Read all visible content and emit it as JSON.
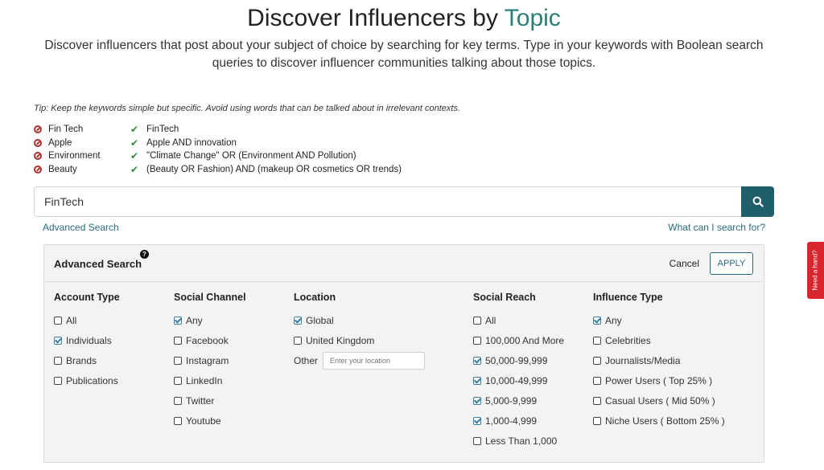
{
  "header": {
    "title_main": "Discover Influencers by",
    "title_accent": "Topic",
    "subtitle": "Discover influencers that post about your subject of choice by searching for key terms. Type in your keywords with Boolean search queries to discover influencer communities talking about those topics."
  },
  "tip": "Tip: Keep the keywords simple but specific. Avoid using words that can be talked about in irrelevant contexts.",
  "examples": [
    {
      "bad": "Fin Tech",
      "good": "FinTech"
    },
    {
      "bad": "Apple",
      "good": "Apple AND innovation"
    },
    {
      "bad": "Environment",
      "good": "\"Climate Change\" OR (Environment AND Pollution)"
    },
    {
      "bad": "Beauty",
      "good": "(Beauty OR Fashion) AND (makeup OR cosmetics OR trends)"
    }
  ],
  "search": {
    "value": "FinTech",
    "advanced_link": "Advanced Search",
    "help_link": "What can I search for?"
  },
  "advanced": {
    "title": "Advanced Search",
    "help_glyph": "?",
    "cancel_label": "Cancel",
    "apply_label": "APPLY",
    "account_type": {
      "heading": "Account Type",
      "options": [
        {
          "label": "All",
          "checked": false
        },
        {
          "label": "Individuals",
          "checked": true
        },
        {
          "label": "Brands",
          "checked": false
        },
        {
          "label": "Publications",
          "checked": false
        }
      ]
    },
    "social_channel": {
      "heading": "Social Channel",
      "options": [
        {
          "label": "Any",
          "checked": true
        },
        {
          "label": "Facebook",
          "checked": false
        },
        {
          "label": "Instagram",
          "checked": false
        },
        {
          "label": "LinkedIn",
          "checked": false
        },
        {
          "label": "Twitter",
          "checked": false
        },
        {
          "label": "Youtube",
          "checked": false
        }
      ]
    },
    "location": {
      "heading": "Location",
      "options": [
        {
          "label": "Global",
          "checked": true
        },
        {
          "label": "United Kingdom",
          "checked": false
        }
      ],
      "other_label": "Other",
      "other_placeholder": "Enter your location"
    },
    "social_reach": {
      "heading": "Social Reach",
      "options": [
        {
          "label": "All",
          "checked": false
        },
        {
          "label": "100,000 And More",
          "checked": false
        },
        {
          "label": "50,000-99,999",
          "checked": true
        },
        {
          "label": "10,000-49,999",
          "checked": true
        },
        {
          "label": "5,000-9,999",
          "checked": true
        },
        {
          "label": "1,000-4,999",
          "checked": true
        },
        {
          "label": "Less Than 1,000",
          "checked": false
        }
      ]
    },
    "influence_type": {
      "heading": "Influence Type",
      "options": [
        {
          "label": "Any",
          "checked": true
        },
        {
          "label": "Celebrities",
          "checked": false
        },
        {
          "label": "Journalists/Media",
          "checked": false
        },
        {
          "label": "Power Users ( Top 25% )",
          "checked": false
        },
        {
          "label": "Casual Users ( Mid 50% )",
          "checked": false
        },
        {
          "label": "Niche Users ( Bottom 25% )",
          "checked": false
        }
      ]
    }
  },
  "help_tab": "Need a hand?",
  "colors": {
    "accent": "#2a7f78",
    "search_button": "#1f5f6b",
    "link": "#2a6a80",
    "help_tab": "#d9262d",
    "bad": "#b03030",
    "good": "#2e8a3a"
  }
}
